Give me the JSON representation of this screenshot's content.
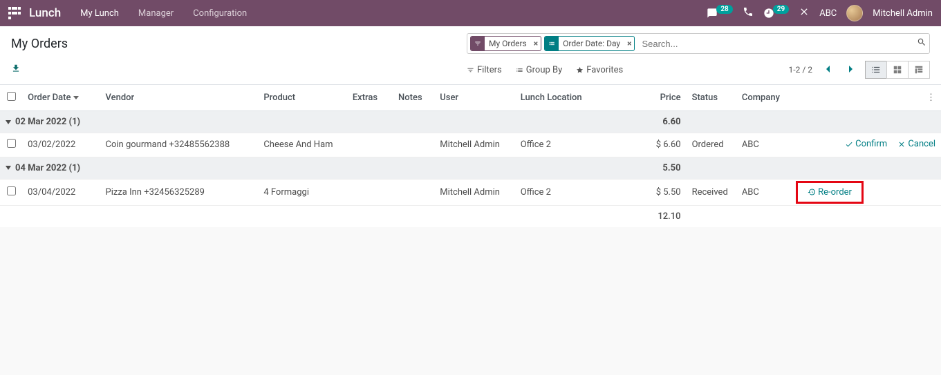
{
  "nav": {
    "brand": "Lunch",
    "items": [
      "My Lunch",
      "Manager",
      "Configuration"
    ],
    "messages_count": "28",
    "activities_count": "29",
    "company": "ABC",
    "user_name": "Mitchell Admin"
  },
  "breadcrumb": "My Orders",
  "search": {
    "facet1_label": "My Orders",
    "facet2_label": "Order Date: Day",
    "placeholder": "Search..."
  },
  "tools": {
    "filters": "Filters",
    "groupby": "Group By",
    "favorites": "Favorites"
  },
  "pager": {
    "text": "1-2 / 2"
  },
  "columns": {
    "date": "Order Date",
    "vendor": "Vendor",
    "product": "Product",
    "extras": "Extras",
    "notes": "Notes",
    "user": "User",
    "location": "Lunch Location",
    "price": "Price",
    "status": "Status",
    "company": "Company"
  },
  "groups": [
    {
      "label": "02 Mar 2022 (1)",
      "price_sum": "6.60",
      "rows": [
        {
          "date": "03/02/2022",
          "vendor": "Coin gourmand +32485562388",
          "product": "Cheese And Ham",
          "extras": "",
          "notes": "",
          "user": "Mitchell Admin",
          "location": "Office 2",
          "price": "$ 6.60",
          "status": "Ordered",
          "company": "ABC",
          "actions": {
            "confirm": "Confirm",
            "cancel": "Cancel"
          }
        }
      ]
    },
    {
      "label": "04 Mar 2022 (1)",
      "price_sum": "5.50",
      "rows": [
        {
          "date": "03/04/2022",
          "vendor": "Pizza Inn +32456325289",
          "product": "4 Formaggi",
          "extras": "",
          "notes": "",
          "user": "Mitchell Admin",
          "location": "Office 2",
          "price": "$ 5.50",
          "status": "Received",
          "company": "ABC",
          "actions": {
            "reorder": "Re-order"
          }
        }
      ]
    }
  ],
  "total_price": "12.10"
}
